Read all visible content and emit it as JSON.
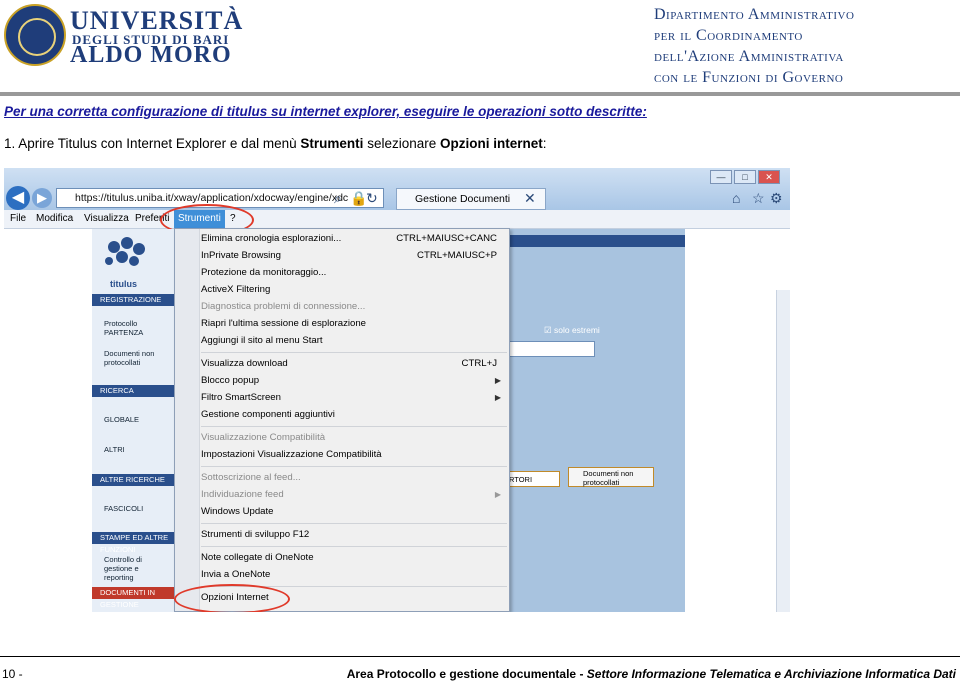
{
  "header": {
    "univ_line1": "UNIVERSITÀ",
    "univ_line2": "DEGLI STUDI DI BARI",
    "univ_line3": "ALDO MORO",
    "dept_lines": [
      "Dipartimento Amministrativo",
      "per il Coordinamento",
      "dell'Azione Amministrativa",
      "con le Funzioni di Governo"
    ]
  },
  "intro": "Per una corretta configurazione di titulus su internet explorer, eseguire le operazioni sotto descritte:",
  "step1": {
    "prefix": "1. Aprire Titulus con Internet Explorer e dal menù ",
    "menu": "Strumenti",
    "middle": " selezionare ",
    "option": "Opzioni internet",
    "suffix": ":"
  },
  "browser": {
    "url": "https://titulus.uniba.it/xway/application/xdocway/engine/xdc",
    "tab_title": "Gestione Documenti",
    "menu": [
      "File",
      "Modifica",
      "Visualizza",
      "Preferiti",
      "Strumenti",
      "?"
    ],
    "active_menu": "Strumenti",
    "window_buttons": [
      "—",
      "□",
      "✕"
    ]
  },
  "titulus_page": {
    "logo_text": "titulus",
    "sections": {
      "registrazione": "REGISTRAZIONE",
      "ricerca": "RICERCA",
      "altre_ricerche": "ALTRE RICERCHE",
      "stampe": "STAMPE ED ALTRE FUNZIONI",
      "documenti_in_gestione": "DOCUMENTI IN GESTIONE"
    },
    "items": {
      "protocollo": "Protocollo PARTENZA",
      "documenti_np": "Documenti non protocollati",
      "globale": "GLOBALE",
      "altri": "ALTRI",
      "fascicoli": "FASCICOLI",
      "controllo": "Controllo di gestione e reporting"
    },
    "right": {
      "checkbox": "solo estremi",
      "btn1": "RTORI",
      "btn2": "Documenti non protocollati"
    }
  },
  "dropdown": [
    {
      "label": "Elimina cronologia esplorazioni...",
      "shortcut": "CTRL+MAIUSC+CANC",
      "disabled": false
    },
    {
      "label": "InPrivate Browsing",
      "shortcut": "CTRL+MAIUSC+P",
      "disabled": false
    },
    {
      "label": "Protezione da monitoraggio...",
      "shortcut": "",
      "disabled": false
    },
    {
      "label": "ActiveX Filtering",
      "shortcut": "",
      "disabled": false
    },
    {
      "label": "Diagnostica problemi di connessione...",
      "shortcut": "",
      "disabled": true
    },
    {
      "label": "Riapri l'ultima sessione di esplorazione",
      "shortcut": "",
      "disabled": false
    },
    {
      "label": "Aggiungi il sito al menu Start",
      "shortcut": "",
      "disabled": false
    },
    {
      "label": "Visualizza download",
      "shortcut": "CTRL+J",
      "disabled": false
    },
    {
      "label": "Blocco popup",
      "shortcut": "",
      "disabled": false,
      "submenu": true
    },
    {
      "label": "Filtro SmartScreen",
      "shortcut": "",
      "disabled": false,
      "submenu": true
    },
    {
      "label": "Gestione componenti aggiuntivi",
      "shortcut": "",
      "disabled": false
    },
    {
      "label": "Visualizzazione Compatibilità",
      "shortcut": "",
      "disabled": true
    },
    {
      "label": "Impostazioni Visualizzazione Compatibilità",
      "shortcut": "",
      "disabled": false
    },
    {
      "label": "Sottoscrizione al feed...",
      "shortcut": "",
      "disabled": true
    },
    {
      "label": "Individuazione feed",
      "shortcut": "",
      "disabled": true,
      "submenu": true
    },
    {
      "label": "Windows Update",
      "shortcut": "",
      "disabled": false
    },
    {
      "label": "Strumenti di sviluppo F12",
      "shortcut": "",
      "disabled": false
    },
    {
      "label": "Note collegate di OneNote",
      "shortcut": "",
      "disabled": false
    },
    {
      "label": "Invia a OneNote",
      "shortcut": "",
      "disabled": false
    },
    {
      "label": "Opzioni Internet",
      "shortcut": "",
      "disabled": false
    }
  ],
  "footer": {
    "page_number": "10 -",
    "left_text": "Area Protocollo e gestione documentale",
    "sep": " - ",
    "right_text": "Settore Informazione Telematica e Archiviazione Informatica Dati"
  },
  "colors": {
    "accent": "#1f3d7a",
    "highlight_circle": "#e03a2a",
    "menu_active": "#3f8fd8"
  }
}
